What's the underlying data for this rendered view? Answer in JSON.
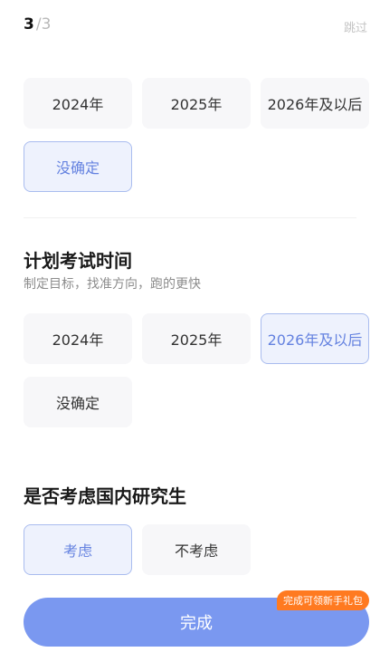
{
  "header": {
    "step_current": "3",
    "step_total": "/3",
    "skip_label": "跳过"
  },
  "section_top": {
    "options": [
      "2024年",
      "2025年",
      "2026年及以后",
      "没确定"
    ],
    "selected": "没确定"
  },
  "section_exam": {
    "title": "计划考试时间",
    "subtitle": "制定目标，找准方向，跑的更快",
    "options": [
      "2024年",
      "2025年",
      "2026年及以后",
      "没确定"
    ],
    "selected": "2026年及以后"
  },
  "section_domestic": {
    "title": "是否考虑国内研究生",
    "options": [
      "考虑",
      "不考虑"
    ],
    "selected": "考虑"
  },
  "footer": {
    "done_label": "完成",
    "badge_text": "完成可领新手礼包"
  },
  "colors": {
    "accent": "#7a98f0",
    "selected_bg": "#eef2fd",
    "selected_border": "#a9bcef",
    "badge": "#ff7a20"
  }
}
